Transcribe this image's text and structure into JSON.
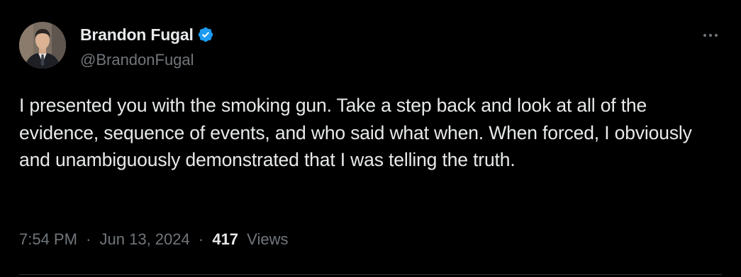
{
  "author": {
    "display_name": "Brandon Fugal",
    "handle": "@BrandonFugal",
    "verified": true
  },
  "tweet": {
    "text": "I presented you with the smoking gun. Take a step back and look at all of the evidence, sequence of events, and who said what when. When forced, I obviously and unambiguously demonstrated that I was telling the truth."
  },
  "meta": {
    "time": "7:54 PM",
    "date": "Jun 13, 2024",
    "separator": "·",
    "views_count": "417",
    "views_label": "Views"
  },
  "icons": {
    "verified": "verified-badge-icon",
    "more": "more-dots-icon"
  },
  "colors": {
    "background": "#000000",
    "primary_text": "#e7e9ea",
    "secondary_text": "#71767b",
    "verified_blue": "#1d9bf0",
    "divider": "#2f3336"
  }
}
